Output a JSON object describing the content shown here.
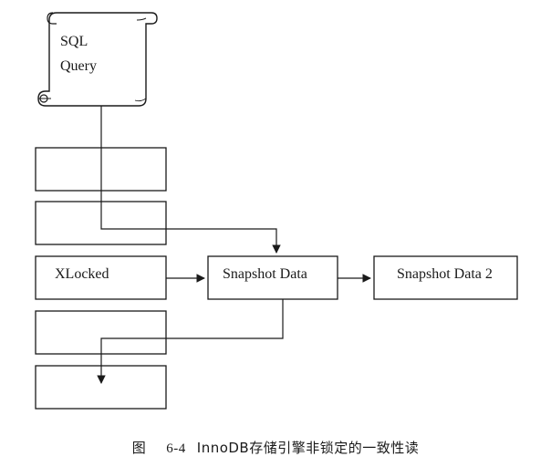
{
  "scroll": {
    "line1": "SQL",
    "line2": "Query"
  },
  "rows": [
    {
      "label": ""
    },
    {
      "label": ""
    },
    {
      "label": "XLocked"
    },
    {
      "label": ""
    },
    {
      "label": ""
    }
  ],
  "snapshot1": {
    "label": "Snapshot Data"
  },
  "snapshot2": {
    "label": "Snapshot Data 2"
  },
  "caption": {
    "prefix": "图",
    "number": "6-4",
    "title": "InnoDB存储引擎非锁定的一致性读"
  }
}
